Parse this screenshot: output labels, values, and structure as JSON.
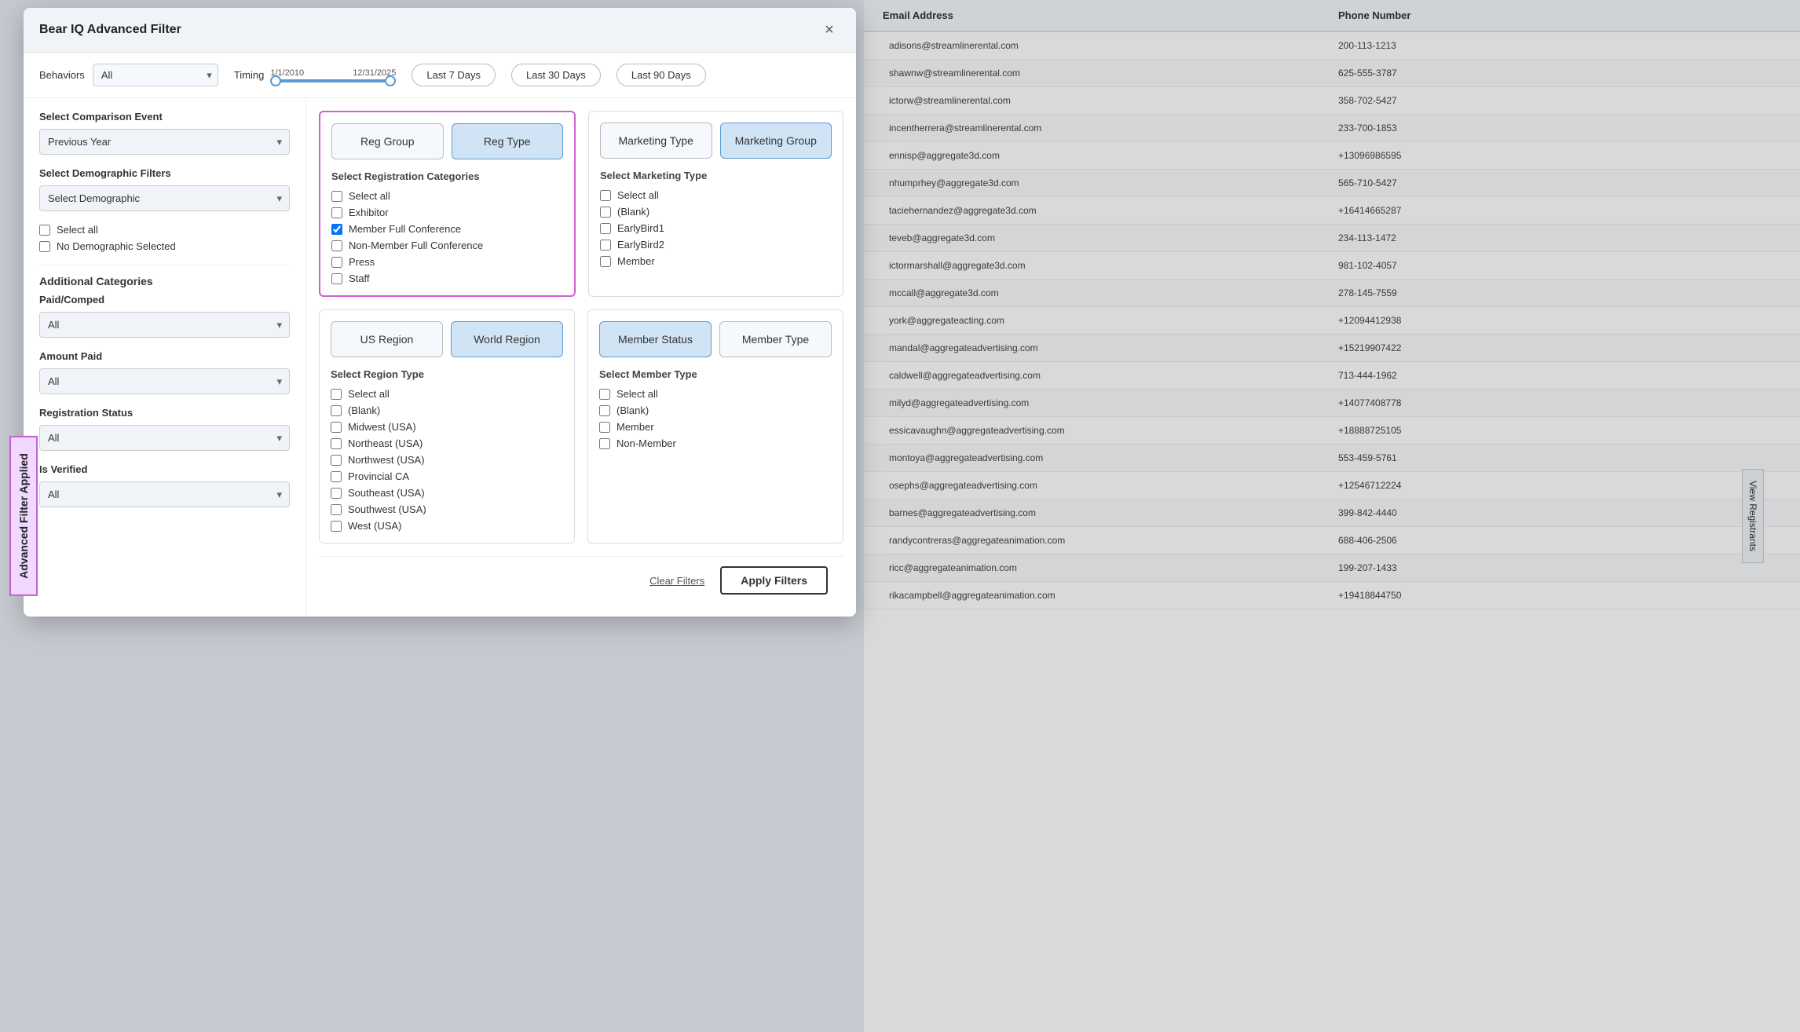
{
  "modal": {
    "title": "Bear IQ Advanced Filter",
    "close_label": "×",
    "behaviors_label": "Behaviors",
    "behaviors_value": "All",
    "timing_label": "Timing",
    "timing_start": "1/1/2010",
    "timing_end": "12/31/2025",
    "time_buttons": [
      {
        "label": "Last 7 Days",
        "id": "last7"
      },
      {
        "label": "Last 30 Days",
        "id": "last30"
      },
      {
        "label": "Last 90 Days",
        "id": "last90"
      }
    ],
    "comparison_event_label": "Select Comparison Event",
    "comparison_event_value": "Previous Year",
    "demographic_filters_label": "Select Demographic Filters",
    "demographic_filters_value": "Select Demographic",
    "demographic_checkboxes": [
      {
        "label": "Select all",
        "checked": false
      },
      {
        "label": "No Demographic Selected",
        "checked": false
      }
    ],
    "additional_categories_label": "Additional Categories",
    "paid_comped_label": "Paid/Comped",
    "paid_comped_value": "All",
    "amount_paid_label": "Amount Paid",
    "amount_paid_value": "All",
    "registration_status_label": "Registration Status",
    "registration_status_value": "All",
    "is_verified_label": "Is Verified",
    "is_verified_value": "All",
    "reg_group_tab": "Reg Group",
    "reg_type_tab": "Reg Type",
    "marketing_type_tab": "Marketing Type",
    "marketing_group_tab": "Marketing Group",
    "reg_categories_label": "Select Registration Categories",
    "reg_categories": [
      {
        "label": "Select all",
        "checked": false
      },
      {
        "label": "Exhibitor",
        "checked": false
      },
      {
        "label": "Member Full Conference",
        "checked": true
      },
      {
        "label": "Non-Member Full Conference",
        "checked": false
      },
      {
        "label": "Press",
        "checked": false
      },
      {
        "label": "Staff",
        "checked": false
      }
    ],
    "marketing_type_label": "Select Marketing Type",
    "marketing_types": [
      {
        "label": "Select all",
        "checked": false
      },
      {
        "label": "(Blank)",
        "checked": false
      },
      {
        "label": "EarlyBird1",
        "checked": false
      },
      {
        "label": "EarlyBird2",
        "checked": false
      },
      {
        "label": "Member",
        "checked": false
      }
    ],
    "us_region_tab": "US Region",
    "world_region_tab": "World Region",
    "member_status_tab": "Member Status",
    "member_type_tab": "Member Type",
    "region_type_label": "Select Region Type",
    "region_types": [
      {
        "label": "Select all",
        "checked": false
      },
      {
        "label": "(Blank)",
        "checked": false
      },
      {
        "label": "Midwest (USA)",
        "checked": false
      },
      {
        "label": "Northeast (USA)",
        "checked": false
      },
      {
        "label": "Northwest (USA)",
        "checked": false
      },
      {
        "label": "Provincial CA",
        "checked": false
      },
      {
        "label": "Southeast (USA)",
        "checked": false
      },
      {
        "label": "Southwest (USA)",
        "checked": false
      },
      {
        "label": "West (USA)",
        "checked": false
      }
    ],
    "member_type_label": "Select Member Type",
    "member_types": [
      {
        "label": "Select all",
        "checked": false
      },
      {
        "label": "(Blank)",
        "checked": false
      },
      {
        "label": "Member",
        "checked": false
      },
      {
        "label": "Non-Member",
        "checked": false
      }
    ],
    "clear_filters_label": "Clear Filters",
    "apply_filters_label": "Apply Filters"
  },
  "advanced_filter_label": "Advanced Filter Applied",
  "table": {
    "columns": [
      "Email Address",
      "Phone Number"
    ],
    "rows": [
      {
        "email": "adisons@streamlinerental.com",
        "phone": "200-113-1213"
      },
      {
        "email": "shawnw@streamlinerental.com",
        "phone": "625-555-3787"
      },
      {
        "email": "ictorw@streamlinerental.com",
        "phone": "358-702-5427"
      },
      {
        "email": "incentherrera@streamlinerental.com",
        "phone": "233-700-1853"
      },
      {
        "email": "ennisp@aggregate3d.com",
        "phone": "+13096986595"
      },
      {
        "email": "nhumprhey@aggregate3d.com",
        "phone": "565-710-5427"
      },
      {
        "email": "taciehernandez@aggregate3d.com",
        "phone": "+16414665287"
      },
      {
        "email": "teveb@aggregate3d.com",
        "phone": "234-113-1472"
      },
      {
        "email": "ictormarshall@aggregate3d.com",
        "phone": "981-102-4057"
      },
      {
        "email": "mccall@aggregate3d.com",
        "phone": "278-145-7559"
      },
      {
        "email": "york@aggregateacting.com",
        "phone": "+12094412938"
      },
      {
        "email": "mandal@aggregateadvertising.com",
        "phone": "+15219907422"
      },
      {
        "email": "caldwell@aggregateadvertising.com",
        "phone": "713-444-1962"
      },
      {
        "email": "milyd@aggregateadvertising.com",
        "phone": "+14077408778"
      },
      {
        "email": "essicavaughn@aggregateadvertising.com",
        "phone": "+18888725105"
      },
      {
        "email": "montoya@aggregateadvertising.com",
        "phone": "553-459-5761"
      },
      {
        "email": "osephs@aggregateadvertising.com",
        "phone": "+12546712224"
      },
      {
        "email": "barnes@aggregateadvertising.com",
        "phone": "399-842-4440"
      },
      {
        "email": "randycontreras@aggregateanimation.com",
        "phone": "688-406-2506"
      },
      {
        "email": "ricc@aggregateanimation.com",
        "phone": "199-207-1433"
      },
      {
        "email": "rikacampbell@aggregateanimation.com",
        "phone": "+19418844750"
      }
    ],
    "view_registrants_label": "View Registrants"
  }
}
